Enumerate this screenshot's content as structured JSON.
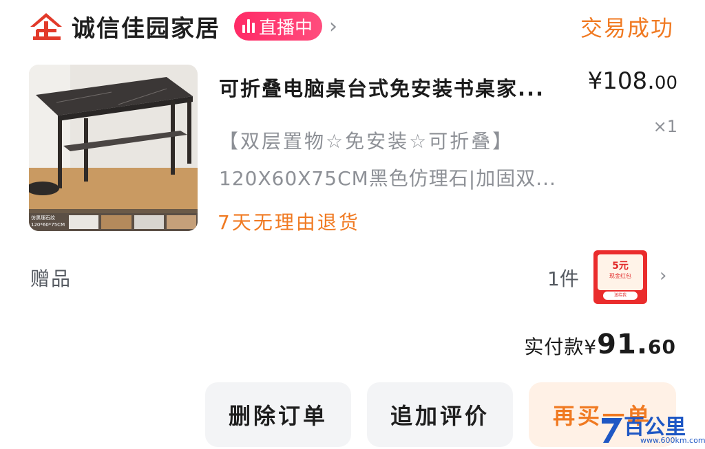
{
  "shop": {
    "name": "诚信佳园家居",
    "live_label": "直播中",
    "order_status": "交易成功"
  },
  "product": {
    "title": "可折叠电脑桌台式免安装书桌家...",
    "price_int": "¥108.",
    "price_dec": "00",
    "quantity": "×1",
    "spec_line1": "【双层置物☆免安装☆可折叠】",
    "spec_line2": "120X60X75CM黑色仿理石|加固双...",
    "return_policy": "7天无理由退货",
    "image_caption": "仿黑理石纹",
    "image_size": "120*60*75CM"
  },
  "gift": {
    "label": "赠品",
    "count": "1件",
    "coupon_amount": "5元",
    "coupon_desc": "现金红包",
    "coupon_foot": "送给我"
  },
  "payment": {
    "label": "实付款",
    "currency": "¥",
    "amount_int": "91.",
    "amount_dec": "60"
  },
  "actions": {
    "delete": "删除订单",
    "review": "追加评价",
    "rebuy": "再买一单"
  },
  "watermark": {
    "text": "百公里",
    "url": "www.600km.com"
  },
  "colors": {
    "accent_orange": "#f07a22",
    "live_pink": "#ff2a66",
    "logo_red": "#e23a2a",
    "muted_gray": "#8d9096"
  }
}
